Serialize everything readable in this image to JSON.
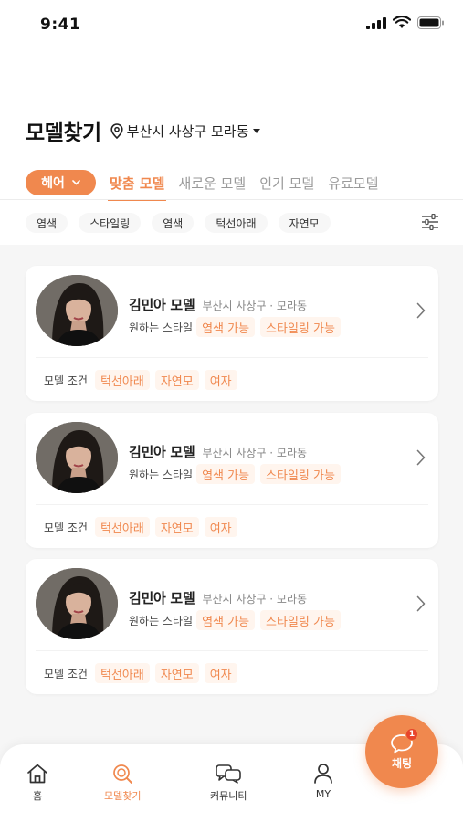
{
  "status_bar": {
    "time": "9:41"
  },
  "header": {
    "title": "모델찾기",
    "location": "부산시 사상구 모라동"
  },
  "category_chip": "헤어",
  "tabs": [
    {
      "label": "맞춤 모델",
      "active": true
    },
    {
      "label": "새로운 모델",
      "active": false
    },
    {
      "label": "인기 모델",
      "active": false
    },
    {
      "label": "유료모델",
      "active": false
    }
  ],
  "filters": [
    "염색",
    "스타일링",
    "염색",
    "턱선아래",
    "자연모"
  ],
  "model_cards": [
    {
      "name": "김민아 모델",
      "location": "부산시 사상구 · 모라동",
      "style_label": "원하는 스타일",
      "styles": [
        "염색 가능",
        "스타일링 가능"
      ],
      "condition_label": "모델 조건",
      "conditions": [
        "턱선아래",
        "자연모",
        "여자"
      ]
    },
    {
      "name": "김민아 모델",
      "location": "부산시 사상구 · 모라동",
      "style_label": "원하는 스타일",
      "styles": [
        "염색 가능",
        "스타일링 가능"
      ],
      "condition_label": "모델 조건",
      "conditions": [
        "턱선아래",
        "자연모",
        "여자"
      ]
    },
    {
      "name": "김민아 모델",
      "location": "부산시 사상구 · 모라동",
      "style_label": "원하는 스타일",
      "styles": [
        "염색 가능",
        "스타일링 가능"
      ],
      "condition_label": "모델 조건",
      "conditions": [
        "턱선아래",
        "자연모",
        "여자"
      ]
    }
  ],
  "bottom_nav": [
    {
      "label": "홈",
      "icon": "home-icon",
      "active": false
    },
    {
      "label": "모델찾기",
      "icon": "model-search-icon",
      "active": true
    },
    {
      "label": "커뮤니티",
      "icon": "community-icon",
      "active": false
    },
    {
      "label": "MY",
      "icon": "person-icon",
      "active": false
    }
  ],
  "chat_button": {
    "label": "채팅",
    "badge": "1"
  },
  "colors": {
    "accent": "#f0884e",
    "tag_bg": "#fff5ee",
    "badge": "#e8452b"
  }
}
